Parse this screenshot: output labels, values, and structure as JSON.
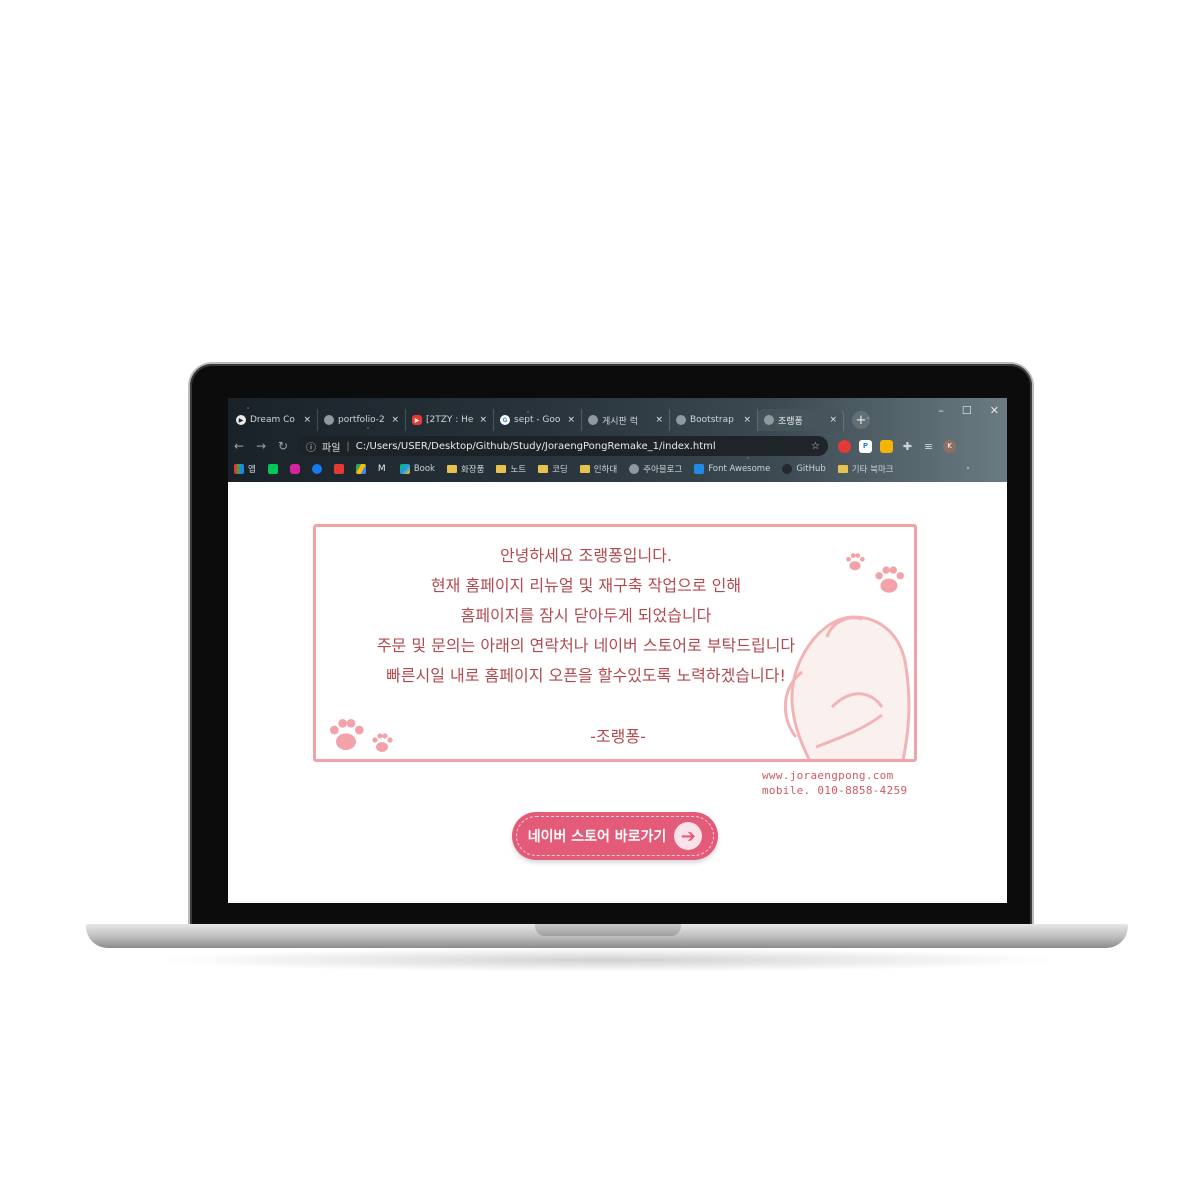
{
  "browser": {
    "tabs": [
      {
        "title": "Dream Co",
        "icon": "dream-coding-icon",
        "color": "#e9e9e9"
      },
      {
        "title": "portfolio-2",
        "icon": "globe-icon",
        "color": "#8e9aa0"
      },
      {
        "title": "[2TZY : He",
        "icon": "youtube-icon",
        "color": "#e53935"
      },
      {
        "title": "sept - Goo",
        "icon": "google-icon",
        "color": "#4285f4"
      },
      {
        "title": "게시판 럭",
        "icon": "globe-icon",
        "color": "#8e9aa0"
      },
      {
        "title": "Bootstrap",
        "icon": "globe-icon",
        "color": "#8e9aa0"
      },
      {
        "title": "조랭퐁",
        "icon": "globe-icon",
        "color": "#8e9aa0"
      }
    ],
    "tab_close_glyph": "×",
    "new_tab_glyph": "+",
    "window_controls": [
      "–",
      "☐",
      "✕"
    ],
    "nav": {
      "back": "←",
      "forward": "→",
      "reload": "↻"
    },
    "address": {
      "scheme_label": "파일",
      "url": "C:/Users/USER/Desktop/Github/Study/JoraengPongRemake_1/index.html"
    },
    "profile_initial": "K",
    "bookmarks": [
      {
        "label": "앱",
        "type": "apps"
      },
      {
        "label": "",
        "type": "naver"
      },
      {
        "label": "",
        "type": "instagram"
      },
      {
        "label": "",
        "type": "facebook"
      },
      {
        "label": "",
        "type": "youtube"
      },
      {
        "label": "",
        "type": "drive"
      },
      {
        "label": "",
        "type": "gmail"
      },
      {
        "label": "Book",
        "type": "play"
      },
      {
        "label": "화장품",
        "type": "folder"
      },
      {
        "label": "노트",
        "type": "folder"
      },
      {
        "label": "코딩",
        "type": "folder"
      },
      {
        "label": "인하대",
        "type": "folder"
      },
      {
        "label": "주아블로그",
        "type": "site"
      },
      {
        "label": "Font Awesome",
        "type": "site"
      },
      {
        "label": "GitHub",
        "type": "site"
      },
      {
        "label": "기타 북마크",
        "type": "folder"
      }
    ]
  },
  "notice": {
    "lines": [
      "안녕하세요 조랭퐁입니다.",
      "현재 홈페이지 리뉴얼 및 재구축 작업으로 인해",
      "홈페이지를 잠시 닫아두게 되었습니다",
      "주문 및 문의는 아래의 연락처나 네이버 스토어로 부탁드립니다",
      "빠른시일 내로 홈페이지 오픈을 할수있도록 노력하겠습니다!"
    ],
    "signature": "-조랭퐁-"
  },
  "contact": {
    "website": "www.joraengpong.com",
    "mobile": "mobile. 010-8858-4259"
  },
  "cta": {
    "label": "네이버 스토어 바로가기",
    "arrow": "➔"
  },
  "colors": {
    "accent": "#e45b7a",
    "border": "#f2a2a8",
    "text": "#b24a4f"
  }
}
